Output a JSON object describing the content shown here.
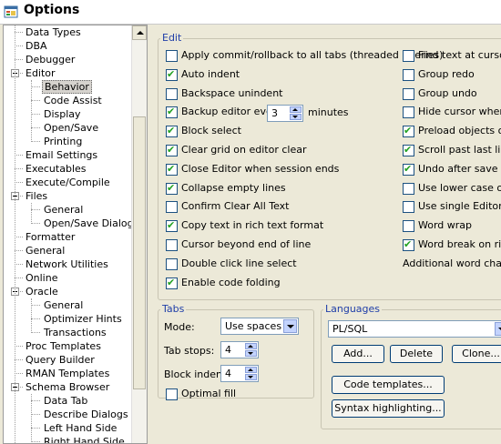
{
  "window": {
    "title": "Options",
    "icon": "options-window-icon"
  },
  "tree": [
    {
      "label": "Data Types",
      "level": 1
    },
    {
      "label": "DBA",
      "level": 1
    },
    {
      "label": "Debugger",
      "level": 1
    },
    {
      "label": "Editor",
      "level": 0,
      "expander": "minus"
    },
    {
      "label": "Behavior",
      "level": 2,
      "selected": true
    },
    {
      "label": "Code Assist",
      "level": 2
    },
    {
      "label": "Display",
      "level": 2
    },
    {
      "label": "Open/Save",
      "level": 2
    },
    {
      "label": "Printing",
      "level": 2
    },
    {
      "label": "Email Settings",
      "level": 1
    },
    {
      "label": "Executables",
      "level": 1
    },
    {
      "label": "Execute/Compile",
      "level": 1
    },
    {
      "label": "Files",
      "level": 0,
      "expander": "minus"
    },
    {
      "label": "General",
      "level": 2
    },
    {
      "label": "Open/Save Dialogs",
      "level": 2
    },
    {
      "label": "Formatter",
      "level": 1
    },
    {
      "label": "General",
      "level": 1
    },
    {
      "label": "Network Utilities",
      "level": 1
    },
    {
      "label": "Online",
      "level": 1
    },
    {
      "label": "Oracle",
      "level": 0,
      "expander": "minus"
    },
    {
      "label": "General",
      "level": 2
    },
    {
      "label": "Optimizer Hints",
      "level": 2
    },
    {
      "label": "Transactions",
      "level": 2
    },
    {
      "label": "Proc Templates",
      "level": 1
    },
    {
      "label": "Query Builder",
      "level": 1
    },
    {
      "label": "RMAN Templates",
      "level": 1
    },
    {
      "label": "Schema Browser",
      "level": 0,
      "expander": "minus"
    },
    {
      "label": "Data Tab",
      "level": 2
    },
    {
      "label": "Describe Dialogs",
      "level": 2
    },
    {
      "label": "Left Hand Side",
      "level": 2
    },
    {
      "label": "Right Hand Side",
      "level": 2
    }
  ],
  "edit": {
    "title": "Edit",
    "left": [
      {
        "label": "Apply commit/rollback to all tabs (threaded queries)",
        "checked": false
      },
      {
        "label": "Auto indent",
        "checked": true
      },
      {
        "label": "Backspace unindent",
        "checked": false
      },
      {
        "label": "Backup editor every",
        "checked": true
      },
      {
        "label": "Block select",
        "checked": true
      },
      {
        "label": "Clear grid on editor clear",
        "checked": true
      },
      {
        "label": "Close Editor when session ends",
        "checked": true
      },
      {
        "label": "Collapse empty lines",
        "checked": true
      },
      {
        "label": "Confirm Clear All Text",
        "checked": false
      },
      {
        "label": "Copy text in rich text format",
        "checked": true
      },
      {
        "label": "Cursor beyond end of line",
        "checked": false
      },
      {
        "label": "Double click line select",
        "checked": false
      },
      {
        "label": "Enable code folding",
        "checked": true
      }
    ],
    "backup_value": "3",
    "backup_unit": "minutes",
    "right": [
      {
        "label": "Find text at cursor",
        "checked": false
      },
      {
        "label": "Group redo",
        "checked": false
      },
      {
        "label": "Group undo",
        "checked": false
      },
      {
        "label": "Hide cursor when typ",
        "checked": false
      },
      {
        "label": "Preload objects on \"l",
        "checked": true
      },
      {
        "label": "Scroll past last line",
        "checked": true
      },
      {
        "label": "Undo after save",
        "checked": true
      },
      {
        "label": "Use lower case objec",
        "checked": false
      },
      {
        "label": "Use single Editor inst",
        "checked": false
      },
      {
        "label": "Word wrap",
        "checked": false
      },
      {
        "label": "Word break on right",
        "checked": true
      }
    ],
    "additional_label": "Additional word charact"
  },
  "tabs": {
    "title": "Tabs",
    "mode_label": "Mode:",
    "mode_value": "Use spaces",
    "tabstops_label": "Tab stops:",
    "tabstops_value": "4",
    "blockindent_label": "Block indent:",
    "blockindent_value": "4",
    "optimal_fill": {
      "label": "Optimal fill",
      "checked": false
    }
  },
  "languages": {
    "title": "Languages",
    "selected": "PL/SQL",
    "add_label": "Add...",
    "delete_label": "Delete",
    "clone_label": "Clone...",
    "code_templates_label": "Code templates...",
    "syntax_label": "Syntax highlighting..."
  },
  "colors": {
    "check": "#21a121",
    "group_title": "#1f3ea8"
  }
}
